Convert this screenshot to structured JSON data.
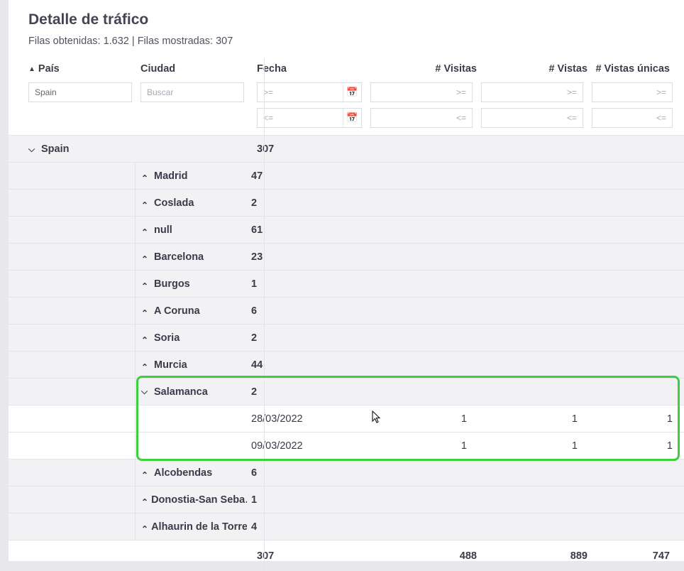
{
  "title": "Detalle de tráfico",
  "rows_obtained_label": "Filas obtenidas: 1.632 | Filas mostradas: 307",
  "headers": {
    "pais": "País",
    "ciudad": "Ciudad",
    "fecha": "Fecha",
    "visitas": "# Visitas",
    "vistas": "# Vistas",
    "unicas": "# Vistas únicas"
  },
  "filters": {
    "pais_value": "Spain",
    "ciudad_placeholder": "Buscar",
    "gte": ">=",
    "lte": "<="
  },
  "group": {
    "name": "Spain",
    "total": "307"
  },
  "cities": [
    {
      "name": "Madrid",
      "val": "47",
      "expanded": false
    },
    {
      "name": "Coslada",
      "val": "2",
      "expanded": false
    },
    {
      "name": "null",
      "val": "61",
      "expanded": false
    },
    {
      "name": "Barcelona",
      "val": "23",
      "expanded": false
    },
    {
      "name": "Burgos",
      "val": "1",
      "expanded": false
    },
    {
      "name": "A Coruna",
      "val": "6",
      "expanded": false
    },
    {
      "name": "Soria",
      "val": "2",
      "expanded": false
    },
    {
      "name": "Murcia",
      "val": "44",
      "expanded": false
    },
    {
      "name": "Salamanca",
      "val": "2",
      "expanded": true,
      "details": [
        {
          "fecha": "28/03/2022",
          "visitas": "1",
          "vistas": "1",
          "unicas": "1"
        },
        {
          "fecha": "09/03/2022",
          "visitas": "1",
          "vistas": "1",
          "unicas": "1"
        }
      ]
    },
    {
      "name": "Alcobendas",
      "val": "6",
      "expanded": false
    },
    {
      "name": "Donostia-San Seba…",
      "val": "1",
      "expanded": false
    },
    {
      "name": "Alhaurin de la Torre",
      "val": "4",
      "expanded": false
    }
  ],
  "footer": {
    "fecha": "307",
    "visitas": "488",
    "vistas": "889",
    "unicas": "747"
  }
}
